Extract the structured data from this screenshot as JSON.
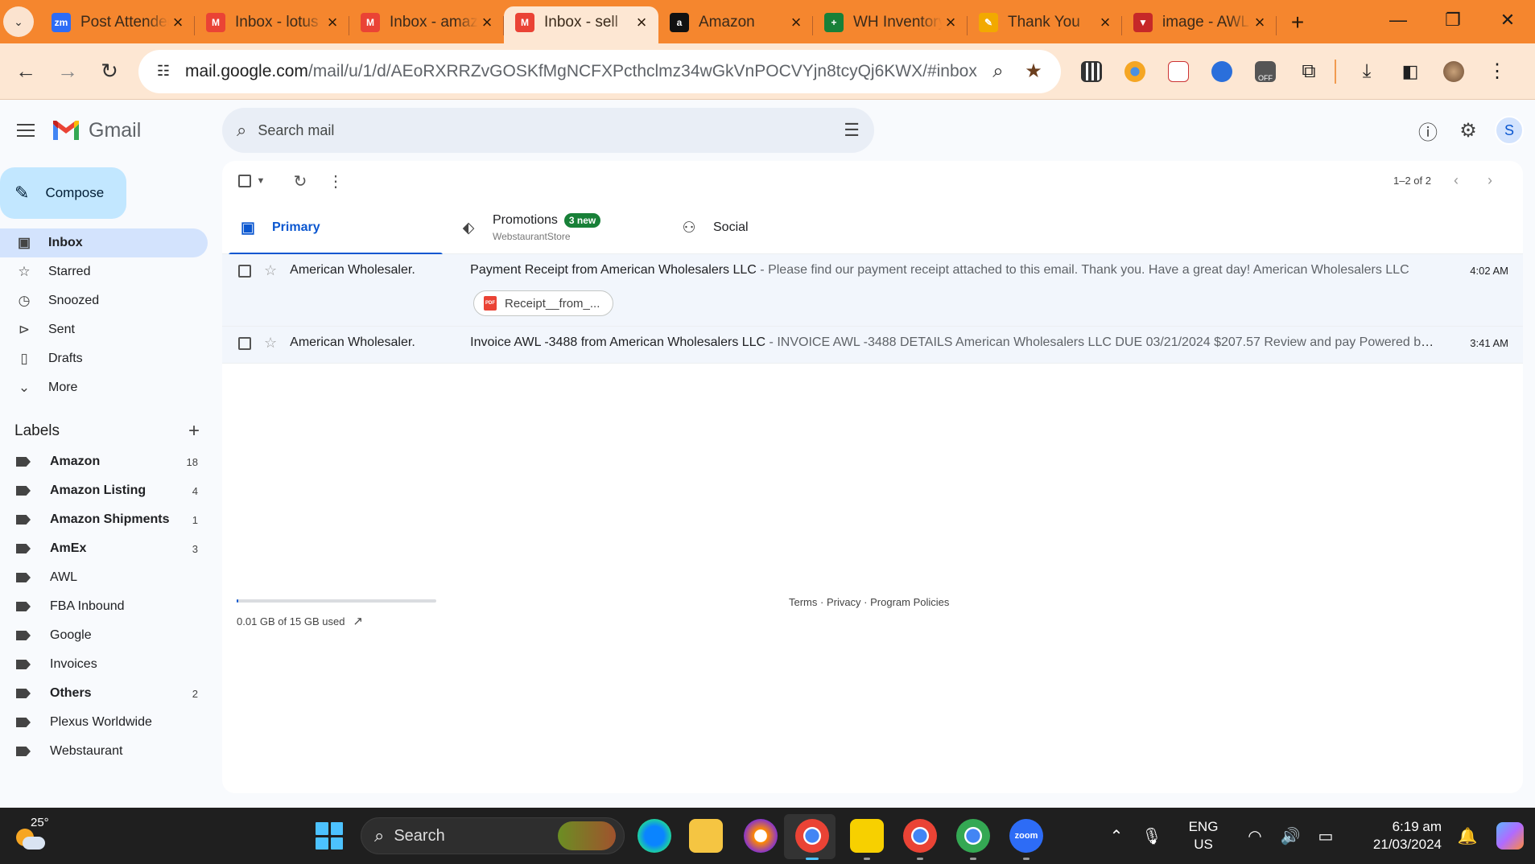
{
  "browser": {
    "tabs": [
      {
        "title": "Post Attendee",
        "favicon": "zoom-icon",
        "color": "#2d6cf6",
        "glyph": "zm"
      },
      {
        "title": "Inbox - lotus",
        "favicon": "gmail-icon",
        "color": "#ea4335",
        "glyph": "M"
      },
      {
        "title": "Inbox - amazon",
        "favicon": "gmail-icon",
        "color": "#ea4335",
        "glyph": "M"
      },
      {
        "title": "Inbox - sell",
        "favicon": "gmail-icon",
        "color": "#ea4335",
        "glyph": "M",
        "active": true
      },
      {
        "title": "Amazon",
        "favicon": "amazon-icon",
        "color": "#111111",
        "glyph": "a"
      },
      {
        "title": "WH Inventory",
        "favicon": "sheets-icon",
        "color": "#188038",
        "glyph": "+"
      },
      {
        "title": "Thank You",
        "favicon": "pencil-icon",
        "color": "#f2a900",
        "glyph": "✎"
      },
      {
        "title": "image - AWL",
        "favicon": "vivaldi-icon",
        "color": "#c62828",
        "glyph": "▼"
      }
    ],
    "address": {
      "host": "mail.google.com",
      "path": "/mail/u/1/d/AEoRXRRZvGOSKfMgNCFXPcthclmz34wGkVnPOCVYjn8tcyQj6KWX/#inbox"
    },
    "theme_color": "#f5862e"
  },
  "gmail": {
    "app_name": "Gmail",
    "search_placeholder": "Search mail",
    "avatar_initial": "S",
    "compose_label": "Compose",
    "nav": [
      {
        "label": "Inbox",
        "icon": "inbox-icon",
        "glyph": "▣",
        "active": true
      },
      {
        "label": "Starred",
        "icon": "star-icon",
        "glyph": "☆"
      },
      {
        "label": "Snoozed",
        "icon": "clock-icon",
        "glyph": "◷"
      },
      {
        "label": "Sent",
        "icon": "send-icon",
        "glyph": "⊳"
      },
      {
        "label": "Drafts",
        "icon": "draft-icon",
        "glyph": "▯"
      },
      {
        "label": "More",
        "icon": "chevron-down-icon",
        "glyph": "⌄"
      }
    ],
    "labels_title": "Labels",
    "labels": [
      {
        "name": "Amazon",
        "count": "18",
        "bold": true
      },
      {
        "name": "Amazon Listing",
        "count": "4",
        "bold": true
      },
      {
        "name": "Amazon Shipments",
        "count": "1",
        "bold": true
      },
      {
        "name": "AmEx",
        "count": "3",
        "bold": true
      },
      {
        "name": "AWL",
        "count": ""
      },
      {
        "name": "FBA Inbound",
        "count": ""
      },
      {
        "name": "Google",
        "count": ""
      },
      {
        "name": "Invoices",
        "count": ""
      },
      {
        "name": "Others",
        "count": "2",
        "bold": true
      },
      {
        "name": "Plexus Worldwide",
        "count": ""
      },
      {
        "name": "Webstaurant",
        "count": ""
      }
    ],
    "pager": "1–2 of 2",
    "categories": {
      "primary": "Primary",
      "promotions": "Promotions",
      "promotions_badge": "3 new",
      "promotions_sub": "WebstaurantStore",
      "social": "Social"
    },
    "emails": [
      {
        "sender": "American Wholesaler.",
        "subject": "Payment Receipt from American Wholesalers LLC",
        "snippet": " - Please find our payment receipt attached to this email. Thank you. Have a great day! American Wholesalers LLC",
        "time": "4:02 AM",
        "attachment": "Receipt__from_..."
      },
      {
        "sender": "American Wholesaler.",
        "subject": "Invoice AWL -3488 from American Wholesalers LLC",
        "snippet": " - INVOICE AWL -3488 DETAILS American Wholesalers LLC DUE 03/21/2024 $207.57 Review and pay Powered by ...",
        "time": "3:41 AM"
      }
    ],
    "storage": {
      "text": "0.01 GB of 15 GB used",
      "used_fraction": 0.01
    },
    "legal": "Terms · Privacy · Program Policies"
  },
  "taskbar": {
    "temperature": "25°",
    "search_label": "Search",
    "lang_line1": "ENG",
    "lang_line2": "US",
    "time": "6:19 am",
    "date": "21/03/2024"
  }
}
